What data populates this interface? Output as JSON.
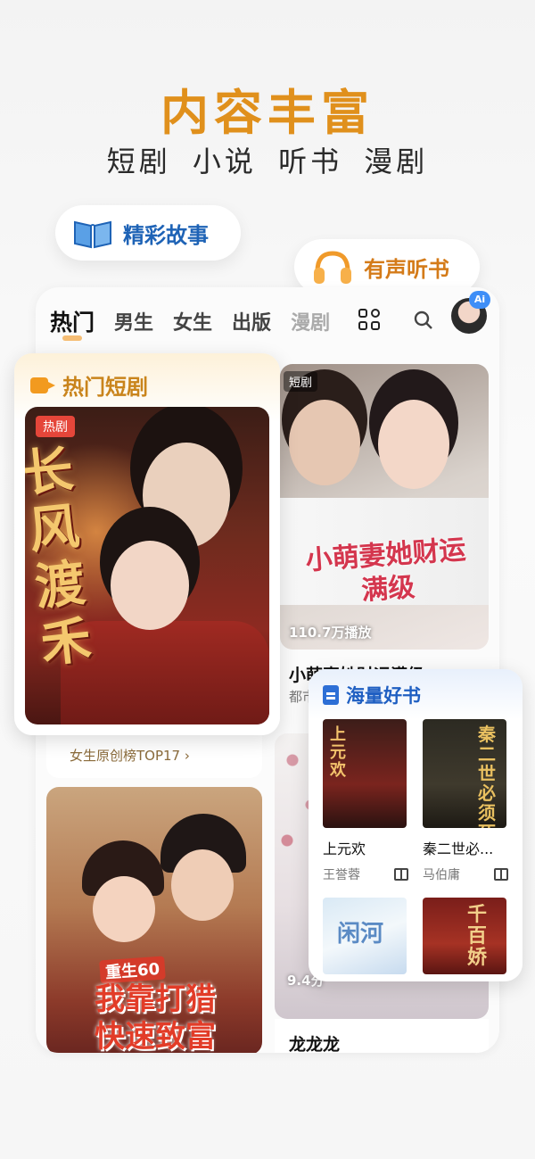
{
  "hero": {
    "title": "内容丰富",
    "subtitle": "短剧 小说 听书 漫剧"
  },
  "bubbles": {
    "story": "精彩故事",
    "audio": "有声听书"
  },
  "nav": {
    "tabs": [
      "热门",
      "男生",
      "女生",
      "出版",
      "漫剧"
    ],
    "ai_badge": "Ai"
  },
  "hot_drama": {
    "title": "热门短剧",
    "badge": "热剧",
    "cover_title": "长风渡禾"
  },
  "feed": {
    "rank_text": "女生原创榜TOP17 ›",
    "drama_badge": "短剧",
    "drama_art": "小萌妻她财运满级",
    "drama_plays": "110.7万播放",
    "drama_name": "小萌妻她财运满级",
    "drama_meta": "都市",
    "cover2_promo_small": "重生60",
    "cover2_promo_line1": "我靠打猎",
    "cover2_promo_line2": "快速致富",
    "score": "9.4分",
    "book_name": "龙龙龙"
  },
  "good_books": {
    "title": "海量好书",
    "books": [
      {
        "name": "上元欢",
        "author": "王誉蓉",
        "cover_text": "上元欢"
      },
      {
        "name": "秦二世必...",
        "author": "马伯庸",
        "cover_text": "秦二世必须死"
      },
      {
        "name": "",
        "author": "",
        "cover_text": "闲河"
      },
      {
        "name": "",
        "author": "",
        "cover_text": "千百娇"
      }
    ]
  },
  "colors": {
    "accent_orange": "#e0901c",
    "accent_blue": "#1f5fc2"
  }
}
